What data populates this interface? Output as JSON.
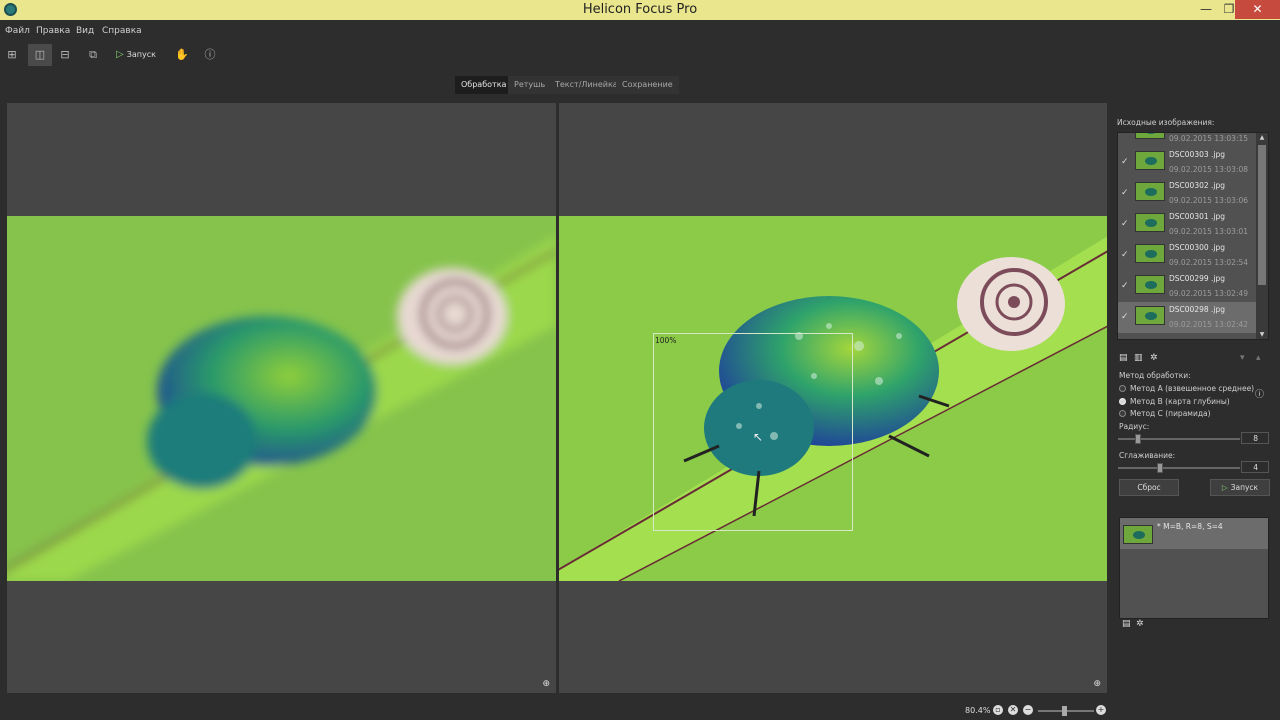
{
  "window": {
    "title": "Helicon Focus Pro"
  },
  "menu": {
    "file": "Файл",
    "edit": "Правка",
    "view": "Вид",
    "help": "Справка"
  },
  "toolbar": {
    "run_label": "Запуск"
  },
  "tabs": [
    {
      "label": "Обработка",
      "active": true
    },
    {
      "label": "Ретушь",
      "active": false
    },
    {
      "label": "Текст/Линейка",
      "active": false
    },
    {
      "label": "Сохранение",
      "active": false
    }
  ],
  "preview": {
    "zoom_box_label": "100%"
  },
  "source_panel": {
    "title": "Исходные изображения:",
    "partial_date": "09.02.2015 13:03:15",
    "files": [
      {
        "name": "DSC00303 .jpg",
        "date": "09.02.2015 13:03:08",
        "checked": true
      },
      {
        "name": "DSC00302 .jpg",
        "date": "09.02.2015 13:03:06",
        "checked": true
      },
      {
        "name": "DSC00301 .jpg",
        "date": "09.02.2015 13:03:01",
        "checked": true
      },
      {
        "name": "DSC00300 .jpg",
        "date": "09.02.2015 13:02:54",
        "checked": true
      },
      {
        "name": "DSC00299 .jpg",
        "date": "09.02.2015 13:02:49",
        "checked": true
      },
      {
        "name": "DSC00298 .jpg",
        "date": "09.02.2015 13:02:42",
        "checked": true,
        "selected": true
      }
    ]
  },
  "method": {
    "title": "Метод обработки:",
    "options": [
      {
        "label": "Метод А (взвешенное среднее)",
        "selected": false
      },
      {
        "label": "Метод В (карта глубины)",
        "selected": true
      },
      {
        "label": "Метод С (пирамида)",
        "selected": false
      }
    ]
  },
  "radius": {
    "label": "Радиус:",
    "value": "8",
    "level": 0.15
  },
  "smoothing": {
    "label": "Сглаживание:",
    "value": "4",
    "level": 0.33
  },
  "buttons": {
    "reset": "Сброс",
    "run": "Запуск"
  },
  "output": {
    "items": [
      {
        "name": "* M=B, R=8, S=4"
      }
    ]
  },
  "status": {
    "zoom": "80.4%"
  },
  "colors": {
    "titlebar": "#e9e68d",
    "close": "#c74a3f",
    "accent_green": "#7fd06b"
  }
}
